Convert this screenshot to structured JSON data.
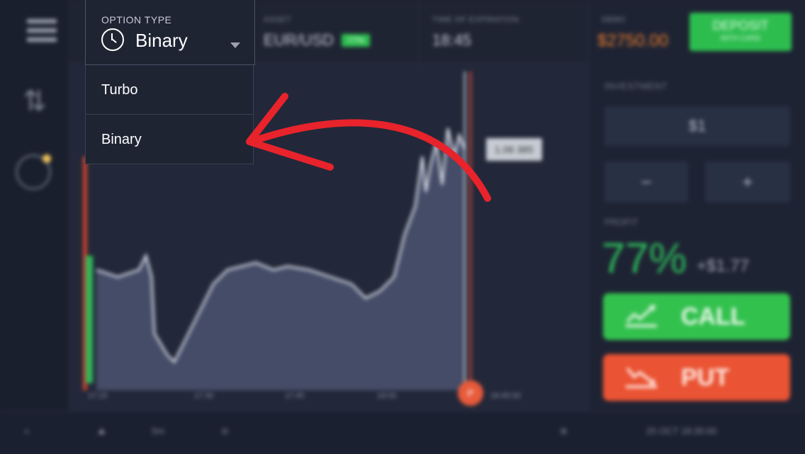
{
  "dropdown": {
    "label": "OPTION TYPE",
    "selected": "Binary",
    "options": [
      "Turbo",
      "Binary"
    ]
  },
  "topbar": {
    "asset_label": "ASSET",
    "asset_value": "EUR/USD",
    "asset_badge": "77%",
    "expiry_label": "TIME OF EXPIRATION",
    "expiry_value": "18:45"
  },
  "chart": {
    "price_tag": "1.06 385",
    "expiry_marker": "P",
    "time_labels": [
      "17:15",
      "17:30",
      "17:45",
      "18:00",
      "18:15"
    ],
    "current_time": "18:45:00",
    "colors": {
      "area": "#4a5270",
      "line": "#d7dbe6",
      "expiry_line": "#c0443a"
    }
  },
  "bottombar": {
    "collapse": "«",
    "chart_type": "5m",
    "status": "25 OCT 18:35:00"
  },
  "panel": {
    "balance_label": "DEMO",
    "balance_value": "$2750.00",
    "deposit_l1": "DEPOSIT",
    "deposit_l2": "WITH CARD",
    "investment_label": "INVESTMENT",
    "investment_value": "$1",
    "minus": "−",
    "plus": "+",
    "profit_label": "PROFIT",
    "profit_pct": "77%",
    "profit_amt": "+$1.77",
    "call_label": "CALL",
    "put_label": "PUT",
    "colors": {
      "call": "#33c14e",
      "put": "#ea5333",
      "accent": "#e67a2c"
    }
  },
  "icons": [
    "menu-icon",
    "trade-arrows-icon",
    "history-icon",
    "clock-icon",
    "caret-down-icon",
    "trend-up-icon",
    "trend-down-icon",
    "red-arrow-annotation"
  ]
}
